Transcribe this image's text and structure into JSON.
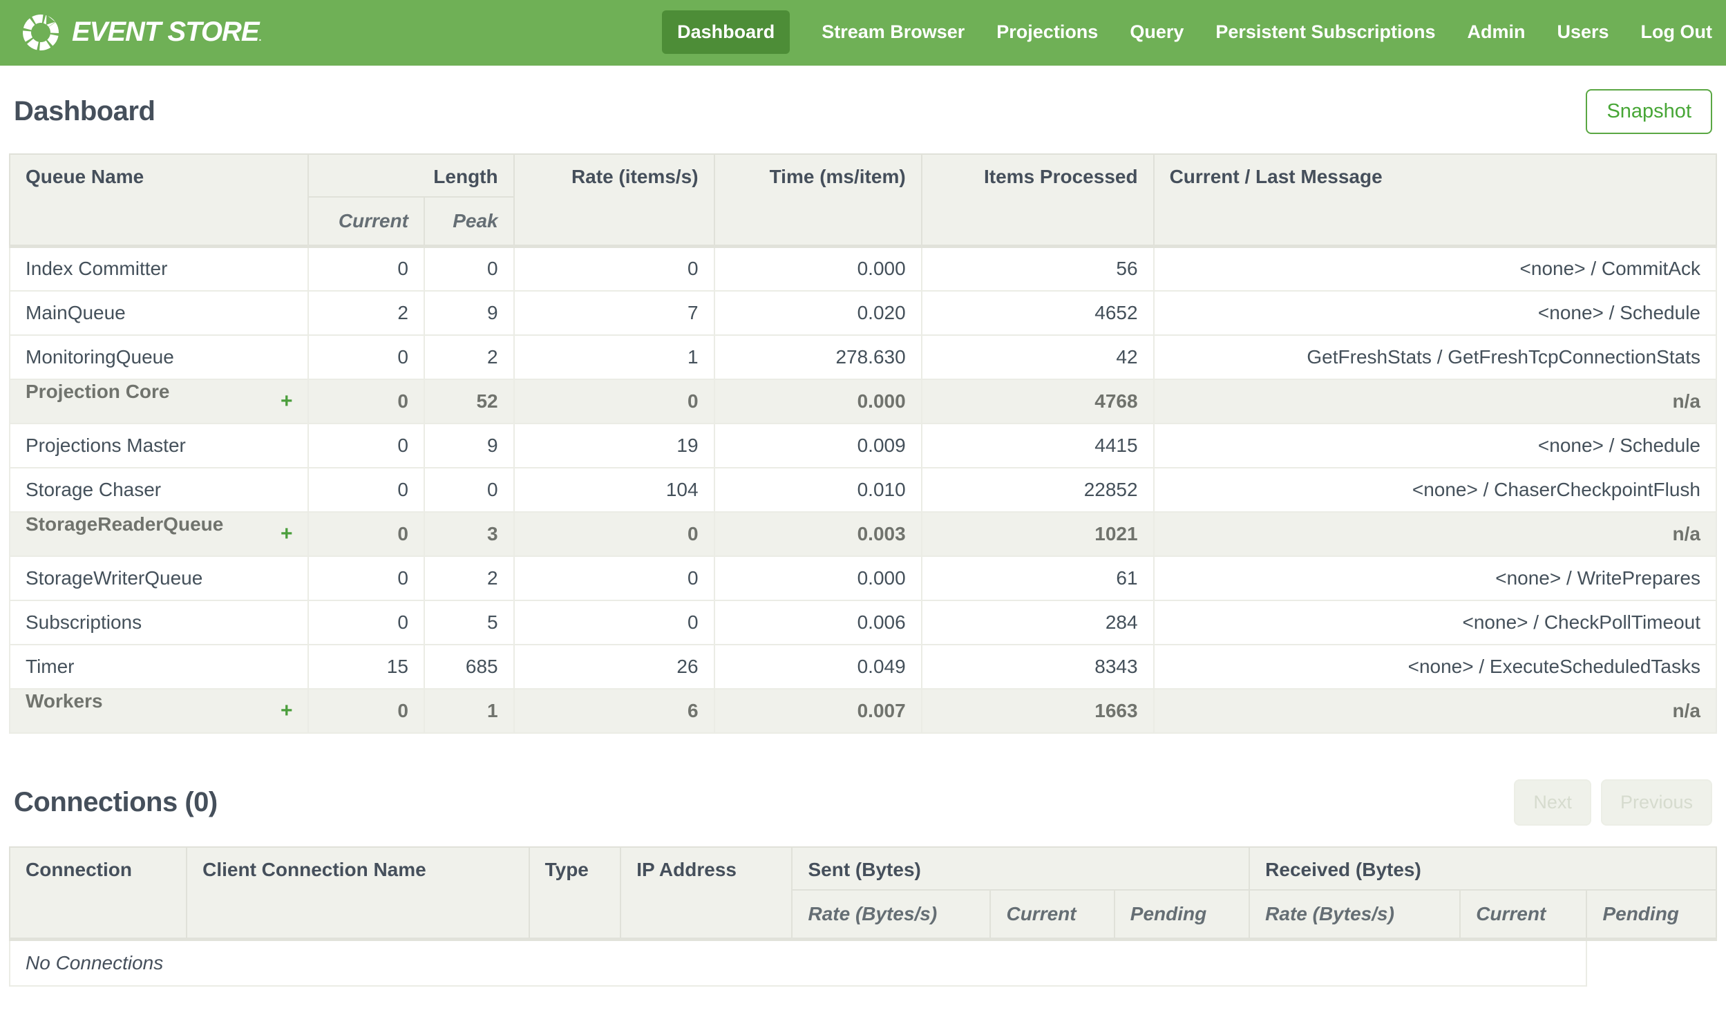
{
  "colors": {
    "header_green": "#6fb056",
    "active_nav_green": "#4d8d37",
    "accent_green": "#47a636",
    "plus_green": "#4b9e3c",
    "heading_ink": "#454f5b",
    "table_header_bg": "#f0f1eb"
  },
  "nav": {
    "logo_text": "EVENT STORE",
    "logo_reg_mark": ".",
    "items": [
      {
        "label": "Dashboard",
        "active": true
      },
      {
        "label": "Stream Browser",
        "active": false
      },
      {
        "label": "Projections",
        "active": false
      },
      {
        "label": "Query",
        "active": false
      },
      {
        "label": "Persistent Subscriptions",
        "active": false
      },
      {
        "label": "Admin",
        "active": false
      },
      {
        "label": "Users",
        "active": false
      },
      {
        "label": "Log Out",
        "active": false
      }
    ]
  },
  "page": {
    "title": "Dashboard",
    "snapshot_label": "Snapshot"
  },
  "queue_table": {
    "headers": {
      "queue_name": "Queue Name",
      "length": "Length",
      "current": "Current",
      "peak": "Peak",
      "rate": "Rate (items/s)",
      "time": "Time (ms/item)",
      "items_processed": "Items Processed",
      "message": "Current / Last Message"
    },
    "expand_glyph": "+",
    "rows": [
      {
        "name": "Index Committer",
        "expandable": false,
        "current": "0",
        "peak": "0",
        "rate": "0",
        "time": "0.000",
        "items": "56",
        "message": "<none> / CommitAck"
      },
      {
        "name": "MainQueue",
        "expandable": false,
        "current": "2",
        "peak": "9",
        "rate": "7",
        "time": "0.020",
        "items": "4652",
        "message": "<none> / Schedule"
      },
      {
        "name": "MonitoringQueue",
        "expandable": false,
        "current": "0",
        "peak": "2",
        "rate": "1",
        "time": "278.630",
        "items": "42",
        "message": "GetFreshStats / GetFreshTcpConnectionStats"
      },
      {
        "name": "Projection Core",
        "expandable": true,
        "current": "0",
        "peak": "52",
        "rate": "0",
        "time": "0.000",
        "items": "4768",
        "message": "n/a"
      },
      {
        "name": "Projections Master",
        "expandable": false,
        "current": "0",
        "peak": "9",
        "rate": "19",
        "time": "0.009",
        "items": "4415",
        "message": "<none> / Schedule"
      },
      {
        "name": "Storage Chaser",
        "expandable": false,
        "current": "0",
        "peak": "0",
        "rate": "104",
        "time": "0.010",
        "items": "22852",
        "message": "<none> / ChaserCheckpointFlush"
      },
      {
        "name": "StorageReaderQueue",
        "expandable": true,
        "current": "0",
        "peak": "3",
        "rate": "0",
        "time": "0.003",
        "items": "1021",
        "message": "n/a"
      },
      {
        "name": "StorageWriterQueue",
        "expandable": false,
        "current": "0",
        "peak": "2",
        "rate": "0",
        "time": "0.000",
        "items": "61",
        "message": "<none> / WritePrepares"
      },
      {
        "name": "Subscriptions",
        "expandable": false,
        "current": "0",
        "peak": "5",
        "rate": "0",
        "time": "0.006",
        "items": "284",
        "message": "<none> / CheckPollTimeout"
      },
      {
        "name": "Timer",
        "expandable": false,
        "current": "15",
        "peak": "685",
        "rate": "26",
        "time": "0.049",
        "items": "8343",
        "message": "<none> / ExecuteScheduledTasks"
      },
      {
        "name": "Workers",
        "expandable": true,
        "current": "0",
        "peak": "1",
        "rate": "6",
        "time": "0.007",
        "items": "1663",
        "message": "n/a"
      }
    ]
  },
  "connections": {
    "title": "Connections (0)",
    "next_label": "Next",
    "previous_label": "Previous",
    "headers": {
      "connection": "Connection",
      "client_name": "Client Connection Name",
      "type": "Type",
      "ip": "IP Address",
      "sent": "Sent (Bytes)",
      "received": "Received (Bytes)",
      "rate": "Rate (Bytes/s)",
      "current": "Current",
      "pending": "Pending"
    },
    "empty_text": "No Connections"
  }
}
